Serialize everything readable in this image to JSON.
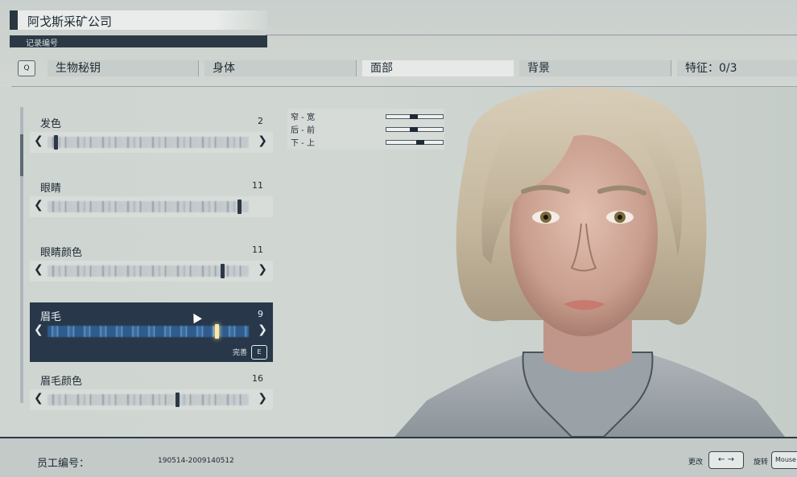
{
  "header": {
    "company": "阿戈斯采矿公司",
    "subtitle": "记录编号"
  },
  "tabs": {
    "key_hint": "Q",
    "items": [
      "生物秘钥",
      "身体",
      "面部",
      "背景",
      "特征：0/3"
    ],
    "active_index": 2
  },
  "sliders": [
    {
      "label": "发色",
      "value": "2"
    },
    {
      "label": "眼睛",
      "value": "11"
    },
    {
      "label": "眼睛颜色",
      "value": "11"
    },
    {
      "label": "眉毛",
      "value": "9",
      "selected": true
    },
    {
      "label": "眉毛颜色",
      "value": "16"
    }
  ],
  "selected_actions": {
    "done_label": "完善",
    "done_key": "E"
  },
  "position_sliders": [
    {
      "label": "窄 - 宽"
    },
    {
      "label": "后 - 前"
    },
    {
      "label": "下 - 上"
    }
  ],
  "footer": {
    "employee_label": "员工编号：",
    "employee_id": "190514-2009140512",
    "change_label": "更改",
    "change_keys": "← →",
    "rotate_label": "旋转",
    "rotate_key": "Mouse"
  },
  "colors": {
    "panel_dark": "#2c3945",
    "selected_row": "#28384a",
    "accent_glow": "#ffe8a0",
    "background": "#cdd3cf"
  }
}
